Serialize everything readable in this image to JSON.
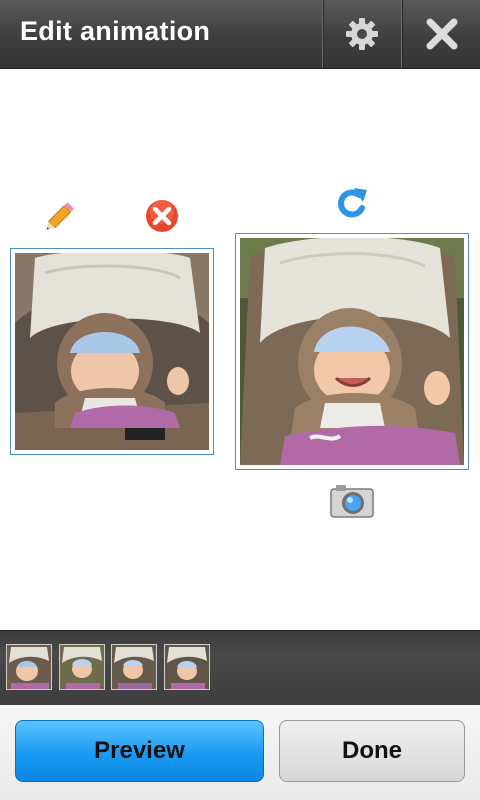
{
  "header": {
    "title": "Edit animation",
    "settings_icon": "gear-icon",
    "close_icon": "close-icon"
  },
  "editor": {
    "left_frame": {
      "actions": [
        "pencil-icon",
        "delete-icon"
      ]
    },
    "right_frame": {
      "actions": [
        "rotate-icon",
        "camera-icon"
      ]
    }
  },
  "filmstrip": {
    "thumbnails": 4
  },
  "footer": {
    "preview_label": "Preview",
    "done_label": "Done"
  },
  "colors": {
    "accent": "#1a9bf2",
    "frame_border": "#4d8fc9",
    "titlebar": "#3e3e3e"
  }
}
